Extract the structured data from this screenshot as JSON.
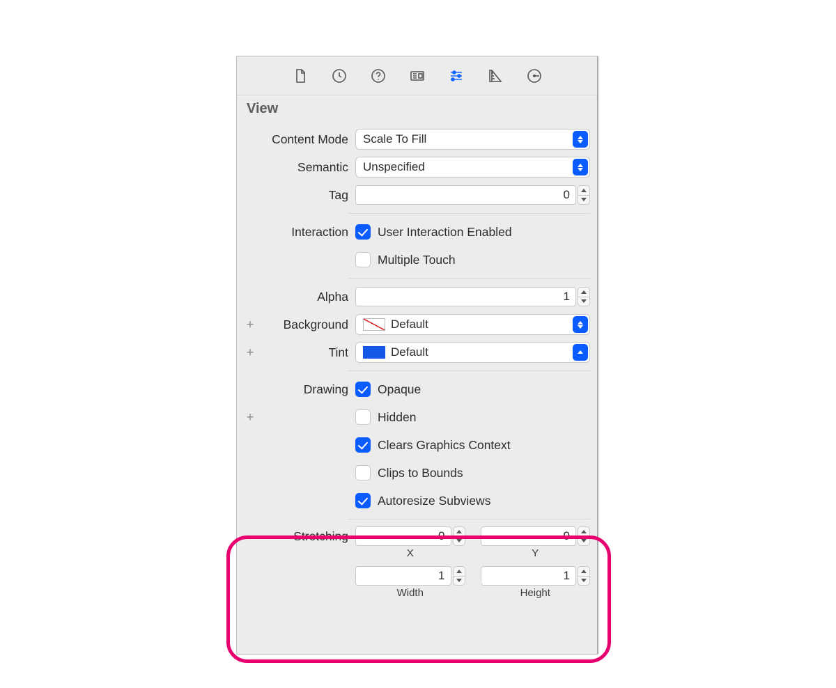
{
  "section": {
    "title": "View"
  },
  "labels": {
    "contentMode": "Content Mode",
    "semantic": "Semantic",
    "tag": "Tag",
    "interaction": "Interaction",
    "alpha": "Alpha",
    "background": "Background",
    "tint": "Tint",
    "drawing": "Drawing",
    "stretching": "Stretching"
  },
  "values": {
    "contentMode": "Scale To Fill",
    "semantic": "Unspecified",
    "tag": "0",
    "alpha": "1",
    "background": "Default",
    "tint": "Default",
    "stretching": {
      "x": "0",
      "y": "0",
      "width": "1",
      "height": "1"
    }
  },
  "sublabels": {
    "x": "X",
    "y": "Y",
    "width": "Width",
    "height": "Height"
  },
  "checkbox": {
    "userInteraction": "User Interaction Enabled",
    "multipleTouch": "Multiple Touch",
    "opaque": "Opaque",
    "hidden": "Hidden",
    "clearsGraphics": "Clears Graphics Context",
    "clipsToBounds": "Clips to Bounds",
    "autoresize": "Autoresize Subviews"
  },
  "gutter": {
    "plus": "+"
  }
}
